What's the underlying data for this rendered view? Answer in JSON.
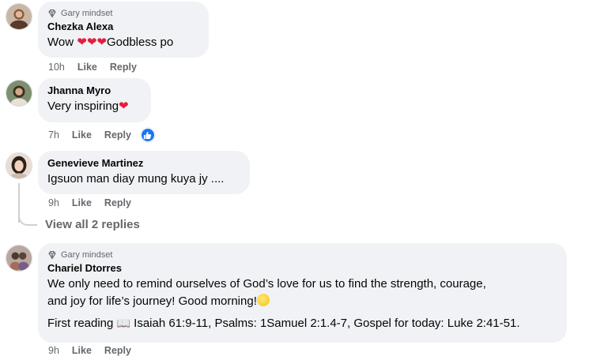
{
  "comments": [
    {
      "badge": "Gary mindset",
      "author": "Chezka Alexa",
      "text": "Wow",
      "text_suffix": "Godbless po",
      "time": "10h",
      "like": "Like",
      "reply": "Reply"
    },
    {
      "author": "Jhanna Myro",
      "text": "Very inspiring",
      "time": "7h",
      "like": "Like",
      "reply": "Reply"
    },
    {
      "author": "Genevieve Martinez",
      "text": "Igsuon man diay mung kuya jy ....",
      "time": "9h",
      "like": "Like",
      "reply": "Reply",
      "view_replies": "View all 2 replies"
    },
    {
      "badge": "Gary mindset",
      "author": "Chariel Dtorres",
      "text_line1": "We only need to remind ourselves of God’s love for us to find the strength, courage,",
      "text_line2": "and joy for life’s journey! Good morning!",
      "reading_prefix": "First reading",
      "reading_text": "Isaiah 61:9-11, Psalms: 1Samuel 2:1.4-7, Gospel for today: Luke 2:41-51.",
      "time": "9h",
      "like": "Like",
      "reply": "Reply"
    }
  ],
  "icons": {
    "badge": "diamond-icon",
    "heart": "red-heart-icon",
    "like_reaction": "thumbs-up-icon",
    "book": "open-book-icon",
    "smiley": "yellow-face-icon"
  },
  "colors": {
    "bubble_bg": "#f0f2f5",
    "meta_text": "#65676b",
    "like_blue": "#1877f2",
    "heart_red": "#e41e3f"
  }
}
